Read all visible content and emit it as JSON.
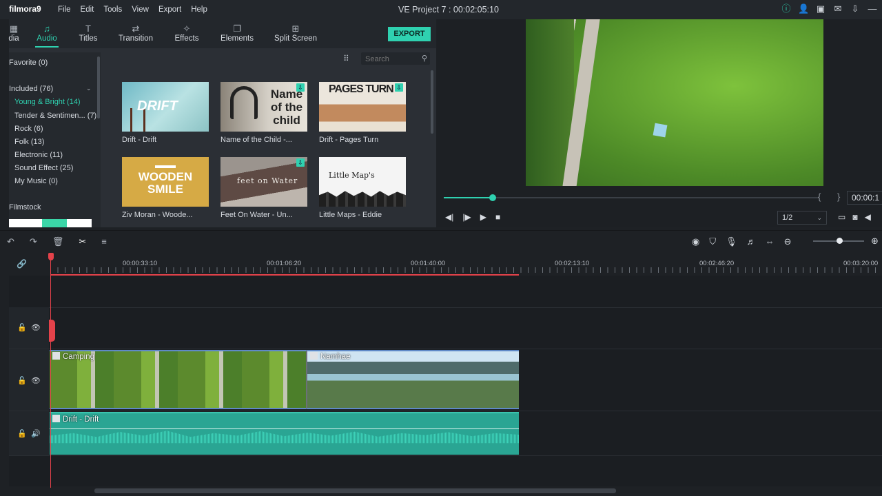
{
  "app": {
    "logo": "filmora9",
    "project_title": "VE Project 7 : 00:02:05:10"
  },
  "menu": [
    "File",
    "Edit",
    "Tools",
    "View",
    "Export",
    "Help"
  ],
  "tabs": [
    {
      "label": "dia",
      "icon": "media-icon"
    },
    {
      "label": "Audio",
      "icon": "music-note-icon",
      "active": true
    },
    {
      "label": "Titles",
      "icon": "text-icon"
    },
    {
      "label": "Transition",
      "icon": "transition-icon"
    },
    {
      "label": "Effects",
      "icon": "effects-icon"
    },
    {
      "label": "Elements",
      "icon": "elements-icon"
    },
    {
      "label": "Split Screen",
      "icon": "split-screen-icon"
    }
  ],
  "export_label": "EXPORT",
  "sidebar": {
    "favorite": "Favorite (0)",
    "included": "Included (76)",
    "items": [
      "Young & Bright (14)",
      "Tender & Sentimen... (7)",
      "Rock (6)",
      "Folk (13)",
      "Electronic (11)",
      "Sound Effect (25)",
      "My Music (0)"
    ],
    "filmstock": "Filmstock"
  },
  "search": {
    "placeholder": "Search"
  },
  "library": [
    {
      "label": "Drift - Drift",
      "art": "DRIFT"
    },
    {
      "label": "Name of the Child -...",
      "art": "Name of the child"
    },
    {
      "label": "Drift - Pages Turn",
      "art": "PAGES TURN"
    },
    {
      "label": "Ziv Moran - Woode...",
      "art": "WOODEN SMILE"
    },
    {
      "label": "Feet On Water - Un...",
      "art": "feet on Water"
    },
    {
      "label": "Little Maps - Eddie",
      "art": "Little Map's"
    }
  ],
  "preview": {
    "progress_fraction": 0.13,
    "timecode": "00:00:1",
    "quality": "1/2"
  },
  "timeline": {
    "ruler_labels": [
      "00:00:33:10",
      "00:01:06:20",
      "00:01:40:00",
      "00:02:13:10",
      "00:02:46:20",
      "00:03:20:00"
    ],
    "video_clips": [
      "Camping",
      "Namhae"
    ],
    "audio_clip": "Drift - Drift"
  },
  "colors": {
    "accent": "#2fd1b0",
    "playhead": "#e4424a",
    "video_clip_border": "#5f89c7",
    "audio_clip": "#2aa593"
  }
}
